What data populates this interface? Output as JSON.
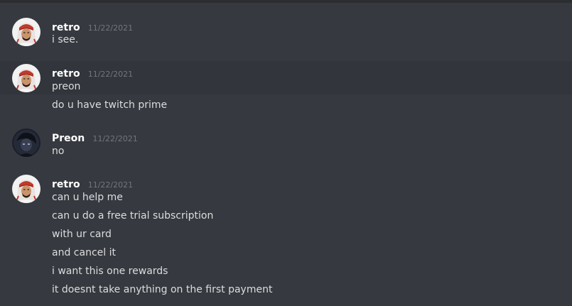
{
  "messages": [
    {
      "author": "retro",
      "timestamp": "11/22/2021",
      "avatar": "arab-headdress-avatar-icon",
      "lines": [
        "i see."
      ]
    },
    {
      "author": "retro",
      "timestamp": "11/22/2021",
      "avatar": "arab-headdress-avatar-icon",
      "lines": [
        "preon",
        "do u have twitch prime"
      ]
    },
    {
      "author": "Preon",
      "timestamp": "11/22/2021",
      "avatar": "dark-anime-avatar-icon",
      "lines": [
        "no"
      ]
    },
    {
      "author": "retro",
      "timestamp": "11/22/2021",
      "avatar": "arab-headdress-avatar-icon",
      "lines": [
        "can u help me",
        "can u do a free trial subscription",
        "with ur card",
        "and cancel it",
        "i want this one rewards",
        "it doesnt take anything on the first payment"
      ]
    }
  ],
  "colors": {
    "background": "#36393f",
    "hover_background": "#32353b",
    "username": "#ffffff",
    "message_text": "#dcddde",
    "timestamp": "#72767d"
  }
}
